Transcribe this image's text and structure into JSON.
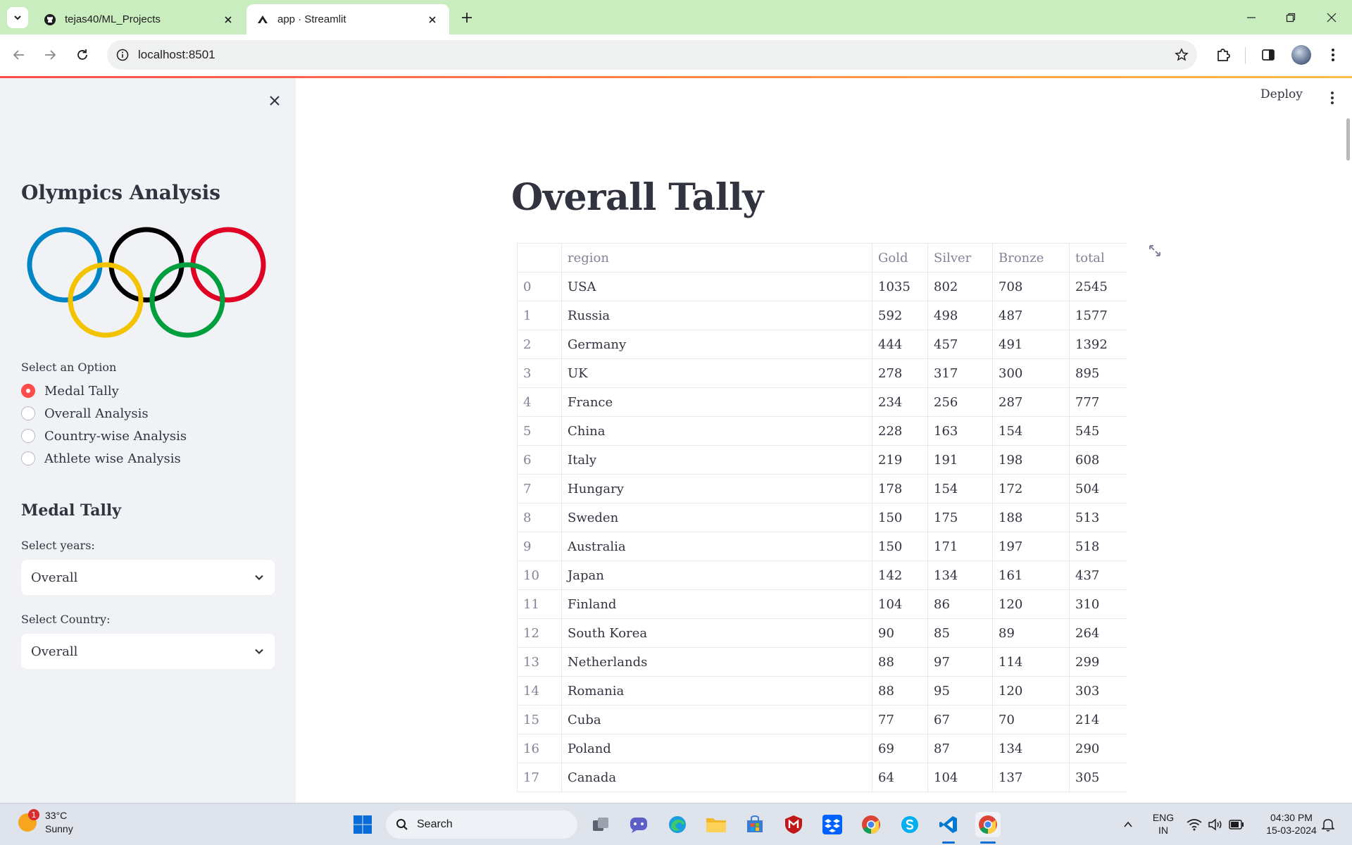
{
  "browser": {
    "tabs": [
      {
        "title": "tejas40/ML_Projects",
        "favicon": "github-icon",
        "active": false
      },
      {
        "title": "app · Streamlit",
        "favicon": "streamlit-icon",
        "active": true
      }
    ],
    "url": "localhost:8501"
  },
  "sidebar": {
    "title": "Olympics Analysis",
    "logo": "olympic-rings",
    "radio_label": "Select an Option",
    "options": [
      {
        "label": "Medal Tally",
        "selected": true
      },
      {
        "label": "Overall Analysis",
        "selected": false
      },
      {
        "label": "Country-wise Analysis",
        "selected": false
      },
      {
        "label": "Athlete wise Analysis",
        "selected": false
      }
    ],
    "subheader": "Medal Tally",
    "years_label": "Select years:",
    "years_value": "Overall",
    "country_label": "Select Country:",
    "country_value": "Overall"
  },
  "header": {
    "deploy_label": "Deploy"
  },
  "main": {
    "title": "Overall Tally",
    "table": {
      "columns": [
        "",
        "region",
        "Gold",
        "Silver",
        "Bronze",
        "total"
      ],
      "rows": [
        [
          "0",
          "USA",
          "1035",
          "802",
          "708",
          "2545"
        ],
        [
          "1",
          "Russia",
          "592",
          "498",
          "487",
          "1577"
        ],
        [
          "2",
          "Germany",
          "444",
          "457",
          "491",
          "1392"
        ],
        [
          "3",
          "UK",
          "278",
          "317",
          "300",
          "895"
        ],
        [
          "4",
          "France",
          "234",
          "256",
          "287",
          "777"
        ],
        [
          "5",
          "China",
          "228",
          "163",
          "154",
          "545"
        ],
        [
          "6",
          "Italy",
          "219",
          "191",
          "198",
          "608"
        ],
        [
          "7",
          "Hungary",
          "178",
          "154",
          "172",
          "504"
        ],
        [
          "8",
          "Sweden",
          "150",
          "175",
          "188",
          "513"
        ],
        [
          "9",
          "Australia",
          "150",
          "171",
          "197",
          "518"
        ],
        [
          "10",
          "Japan",
          "142",
          "134",
          "161",
          "437"
        ],
        [
          "11",
          "Finland",
          "104",
          "86",
          "120",
          "310"
        ],
        [
          "12",
          "South Korea",
          "90",
          "85",
          "89",
          "264"
        ],
        [
          "13",
          "Netherlands",
          "88",
          "97",
          "114",
          "299"
        ],
        [
          "14",
          "Romania",
          "88",
          "95",
          "120",
          "303"
        ],
        [
          "15",
          "Cuba",
          "77",
          "67",
          "70",
          "214"
        ],
        [
          "16",
          "Poland",
          "69",
          "87",
          "134",
          "290"
        ],
        [
          "17",
          "Canada",
          "64",
          "104",
          "137",
          "305"
        ]
      ]
    }
  },
  "taskbar": {
    "weather_temp": "33°C",
    "weather_desc": "Sunny",
    "notification_count": "1",
    "search_label": "Search",
    "lang_line1": "ENG",
    "lang_line2": "IN",
    "time": "04:30 PM",
    "date": "15-03-2024"
  },
  "colors": {
    "accent": "#ff4b4b",
    "sidebar_bg": "#f0f2f6",
    "tabbar_bg": "#c9edbf",
    "text": "#31333f"
  }
}
